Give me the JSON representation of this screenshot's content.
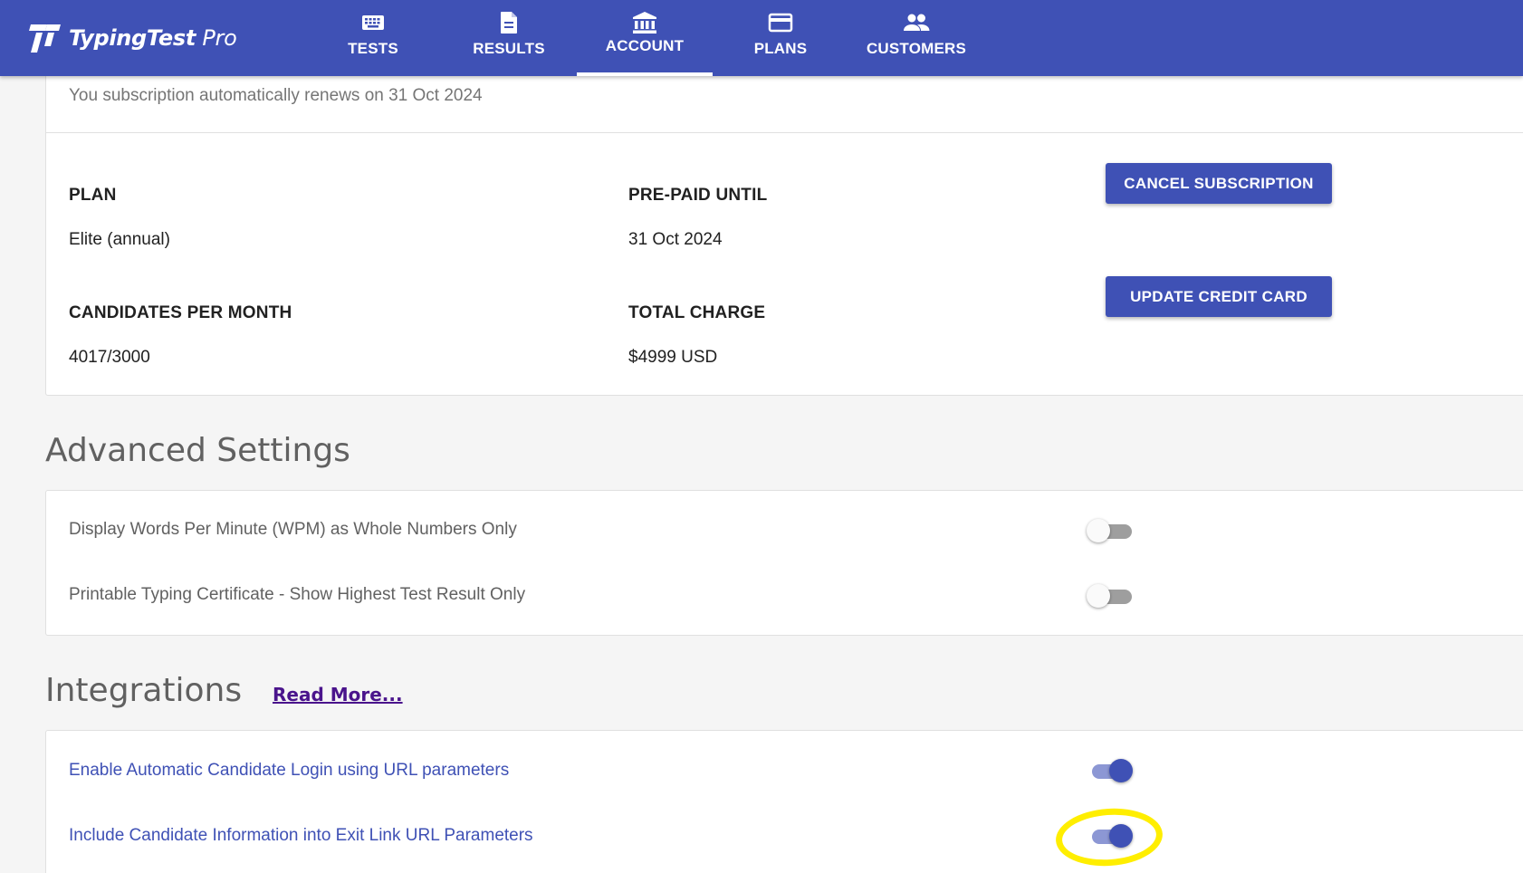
{
  "app": {
    "logo_bold": "TypingTest",
    "logo_light": " Pro",
    "logo_icon": "tt-logo-icon"
  },
  "nav": {
    "tabs": [
      {
        "label": "TESTS",
        "icon": "keyboard-icon",
        "active": false
      },
      {
        "label": "RESULTS",
        "icon": "document-icon",
        "active": false
      },
      {
        "label": "ACCOUNT",
        "icon": "bank-icon",
        "active": true
      },
      {
        "label": "PLANS",
        "icon": "credit-card-icon",
        "active": false
      },
      {
        "label": "CUSTOMERS",
        "icon": "people-icon",
        "active": false
      }
    ]
  },
  "subscription": {
    "renewal_text": "You subscription automatically renews on 31 Oct 2024",
    "plan_label": "PLAN",
    "plan_value": "Elite (annual)",
    "prepaid_label": "PRE-PAID UNTIL",
    "prepaid_value": "31 Oct 2024",
    "candidates_label": "CANDIDATES PER MONTH",
    "candidates_value": "4017/3000",
    "charge_label": "TOTAL CHARGE",
    "charge_value": "$4999 USD",
    "cancel_button": "CANCEL SUBSCRIPTION",
    "update_card_button": "UPDATE CREDIT CARD"
  },
  "advanced": {
    "title": "Advanced Settings",
    "settings": [
      {
        "label": "Display Words Per Minute (WPM) as Whole Numbers Only",
        "enabled": false
      },
      {
        "label": "Printable Typing Certificate - Show Highest Test Result Only",
        "enabled": false
      }
    ]
  },
  "integrations": {
    "title": "Integrations",
    "read_more": "Read More...",
    "settings": [
      {
        "label": "Enable Automatic Candidate Login using URL parameters",
        "enabled": true
      },
      {
        "label": "Include Candidate Information into Exit Link URL Parameters",
        "enabled": true
      }
    ]
  },
  "colors": {
    "primary": "#3f51b5",
    "highlight": "#ffee00",
    "link": "#4a148c"
  }
}
